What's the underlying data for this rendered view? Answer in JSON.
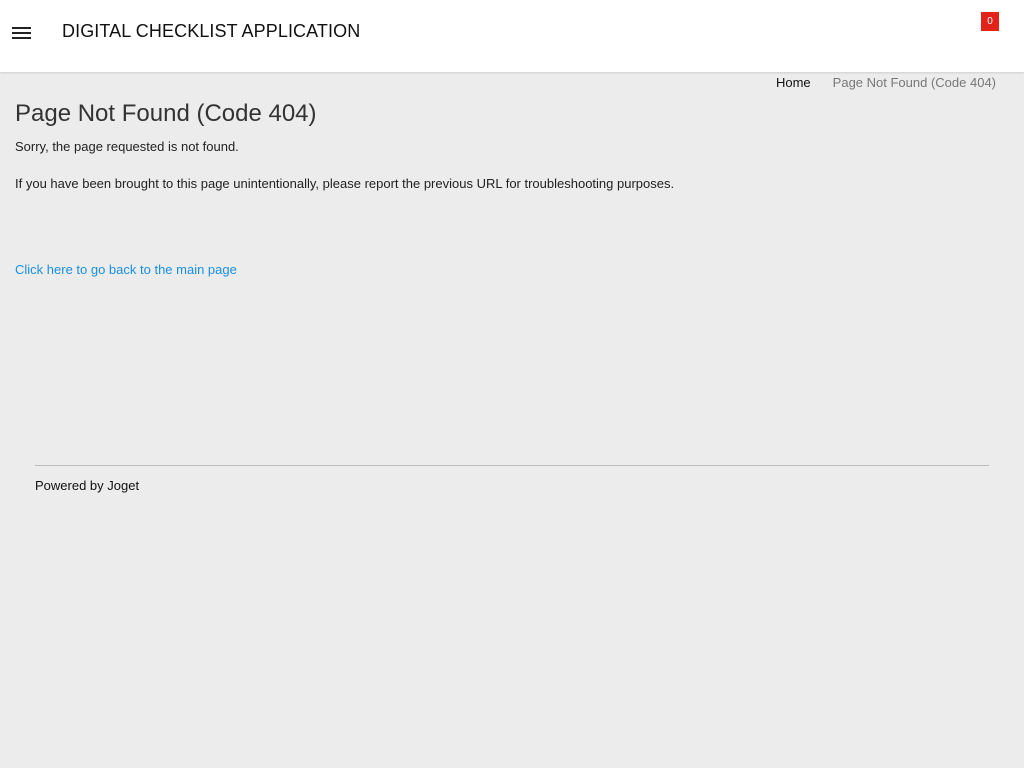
{
  "header": {
    "app_title": "DIGITAL CHECKLIST APPLICATION",
    "notification_count": "0",
    "badge_color": "#e2231a"
  },
  "icons": {
    "menu": "menu-icon"
  },
  "breadcrumb": {
    "home": "Home",
    "current": "Page Not Found (Code 404)"
  },
  "main": {
    "title": "Page Not Found (Code 404)",
    "message": "Sorry, the page requested is not found.",
    "instruction": "If you have been brought to this page unintentionally, please report the previous URL for troubleshooting purposes.",
    "back_link": "Click here to go back to the main page",
    "link_color": "#1a8fe3"
  },
  "footer": {
    "powered_by": "Powered by Joget"
  }
}
